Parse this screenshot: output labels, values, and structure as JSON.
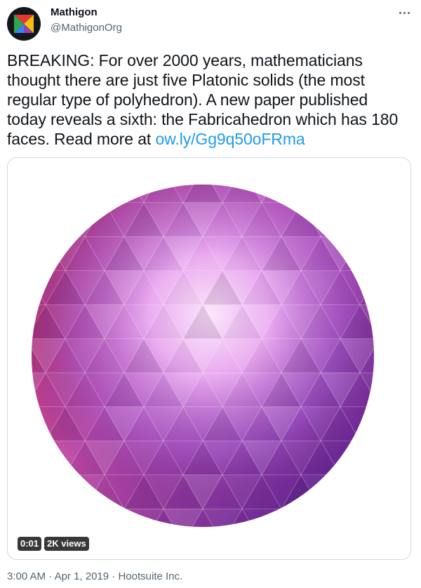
{
  "account": {
    "name": "Mathigon",
    "handle": "@MathigonOrg",
    "avatar_icon": "mathigon-logo-icon"
  },
  "tweet": {
    "text_before_link": "BREAKING: For over 2000 years, mathematicians thought there are just five Platonic solids (the most regular type of polyhedron). A new paper published today reveals a sixth: the Fabricahedron which has 180 faces. Read more at ",
    "link_text": "ow.ly/Gg9q50oFRma"
  },
  "media": {
    "type": "video",
    "elapsed": "0:01",
    "views": "2K views"
  },
  "meta": {
    "time": "3:00 AM",
    "sep1": " · ",
    "date": "Apr 1, 2019",
    "sep2": " · ",
    "source": "Hootsuite Inc."
  },
  "colors": {
    "link": "#1d9bf0",
    "secondary_text": "#536471",
    "border": "#cfd9de"
  }
}
